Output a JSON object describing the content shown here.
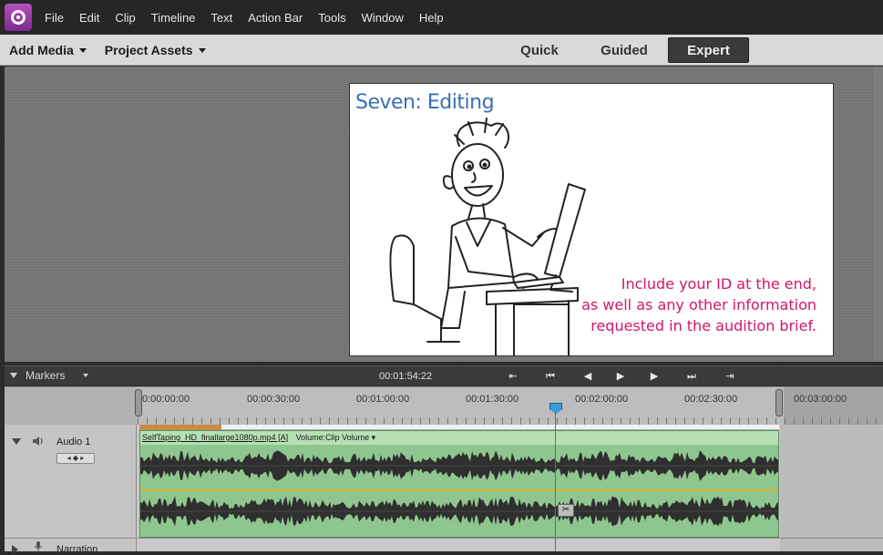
{
  "menubar": {
    "items": [
      "File",
      "Edit",
      "Clip",
      "Timeline",
      "Text",
      "Action Bar",
      "Tools",
      "Window",
      "Help"
    ]
  },
  "toolbar": {
    "add_media": "Add Media",
    "project_assets": "Project Assets",
    "modes": [
      "Quick",
      "Guided",
      "Expert"
    ],
    "active_mode": "Expert"
  },
  "monitor": {
    "title": "Seven: Editing",
    "caption": [
      "Include your ID at the end,",
      "as well as any other information",
      "requested in the audition brief."
    ],
    "title_color": "#3a6fb0",
    "caption_color": "#d4146b"
  },
  "transport": {
    "markers_label": "Markers",
    "timecode": "00:01:54:22",
    "controls": [
      "go-to-in-icon",
      "go-to-start-icon",
      "step-back-icon",
      "play-icon",
      "step-forward-icon",
      "go-to-end-icon",
      "go-to-out-icon"
    ]
  },
  "ruler": {
    "labels": [
      "0:00:00:00",
      "00:00:30:00",
      "00:01:00:00",
      "00:01:30:00",
      "00:02:00:00",
      "00:02:30:00",
      "00:03:00:00"
    ]
  },
  "tracks": {
    "audio1": {
      "name": "Audio 1",
      "clip_name": "SelfTaping_HD_finallarge1080p.mp4 [A]",
      "clip_effect": "Volume:Clip Volume"
    },
    "narration": {
      "name": "Narration"
    }
  },
  "colors": {
    "accent_purple": "#9b3aa8",
    "clip_green": "#8fc68f",
    "playhead_red": "#e23b2b",
    "playhead_blue": "#3b9bd8"
  }
}
